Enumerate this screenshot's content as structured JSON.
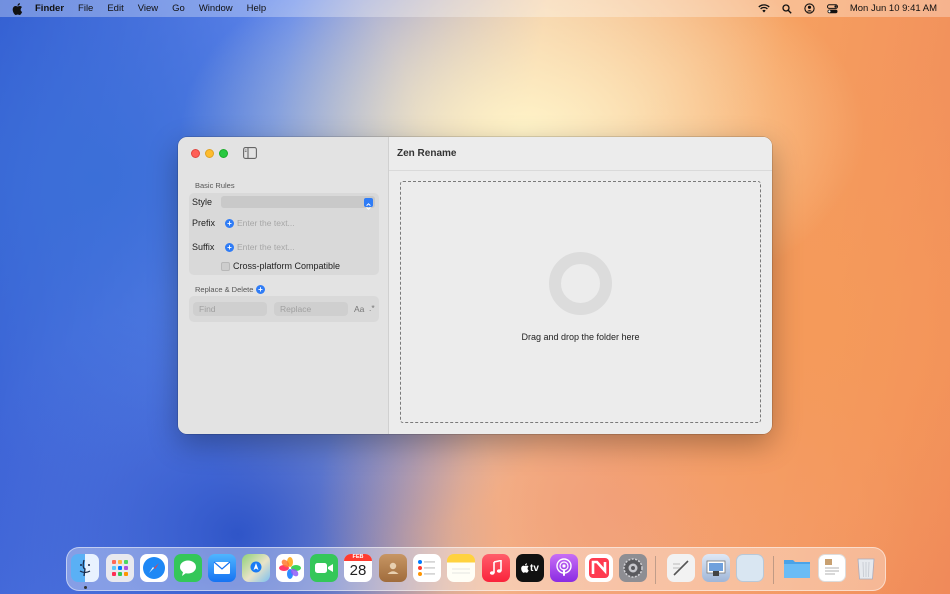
{
  "menubar": {
    "app_name": "Finder",
    "items": [
      "File",
      "Edit",
      "View",
      "Go",
      "Window",
      "Help"
    ],
    "clock": "Mon Jun 10  9:41 AM"
  },
  "window": {
    "sidebar": {
      "basic_rules_title": "Basic Rules",
      "style_label": "Style",
      "prefix_label": "Prefix",
      "prefix_placeholder": "Enter the text...",
      "suffix_label": "Suffix",
      "suffix_placeholder": "Enter the text...",
      "cross_platform_label": "Cross-platform Compatible",
      "replace_delete_title": "Replace & Delete",
      "find_placeholder": "Find",
      "replace_placeholder": "Replace",
      "case_toggle": "Aa",
      "regex_toggle": ".*"
    },
    "main": {
      "title": "Zen Rename",
      "drop_hint": "Drag and drop the folder here"
    }
  },
  "dock": {
    "calendar_month": "FEB",
    "calendar_day": "28",
    "tv_label": "tv",
    "icons": [
      "finder-icon",
      "launchpad-icon",
      "safari-icon",
      "messages-icon",
      "mail-icon",
      "maps-icon",
      "photos-icon",
      "facetime-icon",
      "calendar-icon",
      "contacts-icon",
      "reminders-icon",
      "notes-icon",
      "music-icon",
      "tv-icon",
      "podcasts-icon",
      "news-icon",
      "system-settings-icon",
      "textedit-icon",
      "preview-icon",
      "blank-app-icon",
      "downloads-folder-icon",
      "documents-stack-icon",
      "trash-icon"
    ]
  }
}
